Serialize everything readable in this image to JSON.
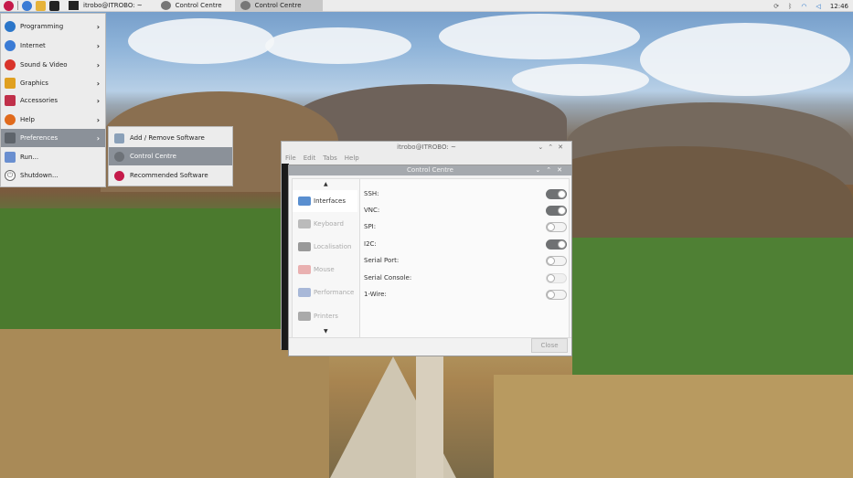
{
  "panel": {
    "tasks": [
      {
        "label": "itrobo@ITROBO: ~"
      },
      {
        "label": "Control Centre"
      },
      {
        "label": "Control Centre"
      }
    ],
    "clock": "12:46"
  },
  "menu": {
    "items": [
      {
        "label": "Programming",
        "icon": "programming-icon",
        "color": "#2b76c9"
      },
      {
        "label": "Internet",
        "icon": "globe-icon",
        "color": "#3a7bd5"
      },
      {
        "label": "Sound & Video",
        "icon": "play-icon",
        "color": "#d9342b"
      },
      {
        "label": "Graphics",
        "icon": "paintbrush-icon",
        "color": "#e0a020"
      },
      {
        "label": "Accessories",
        "icon": "knife-icon",
        "color": "#c0304a"
      },
      {
        "label": "Help",
        "icon": "lifebuoy-icon",
        "color": "#e06a1c"
      },
      {
        "label": "Preferences",
        "icon": "preferences-icon",
        "color": "#7a8088"
      },
      {
        "label": "Run...",
        "icon": "run-icon",
        "color": "#6a8fd0"
      },
      {
        "label": "Shutdown...",
        "icon": "power-icon",
        "color": "#666666"
      }
    ]
  },
  "submenu": {
    "items": [
      {
        "label": "Add / Remove Software"
      },
      {
        "label": "Control Centre"
      },
      {
        "label": "Recommended Software"
      }
    ]
  },
  "terminal": {
    "title": "itrobo@ITROBO: ~",
    "menus": [
      "File",
      "Edit",
      "Tabs",
      "Help"
    ]
  },
  "control_centre": {
    "title": "Control Centre",
    "tabs": [
      {
        "label": "Interfaces"
      },
      {
        "label": "Keyboard"
      },
      {
        "label": "Localisation"
      },
      {
        "label": "Mouse"
      },
      {
        "label": "Performance"
      },
      {
        "label": "Printers"
      }
    ],
    "rows": [
      {
        "label": "SSH:",
        "state": "on"
      },
      {
        "label": "VNC:",
        "state": "on"
      },
      {
        "label": "SPI:",
        "state": "off"
      },
      {
        "label": "I2C:",
        "state": "on"
      },
      {
        "label": "Serial Port:",
        "state": "off"
      },
      {
        "label": "Serial Console:",
        "state": "disabled"
      },
      {
        "label": "1-Wire:",
        "state": "off"
      }
    ],
    "close_label": "Close"
  }
}
